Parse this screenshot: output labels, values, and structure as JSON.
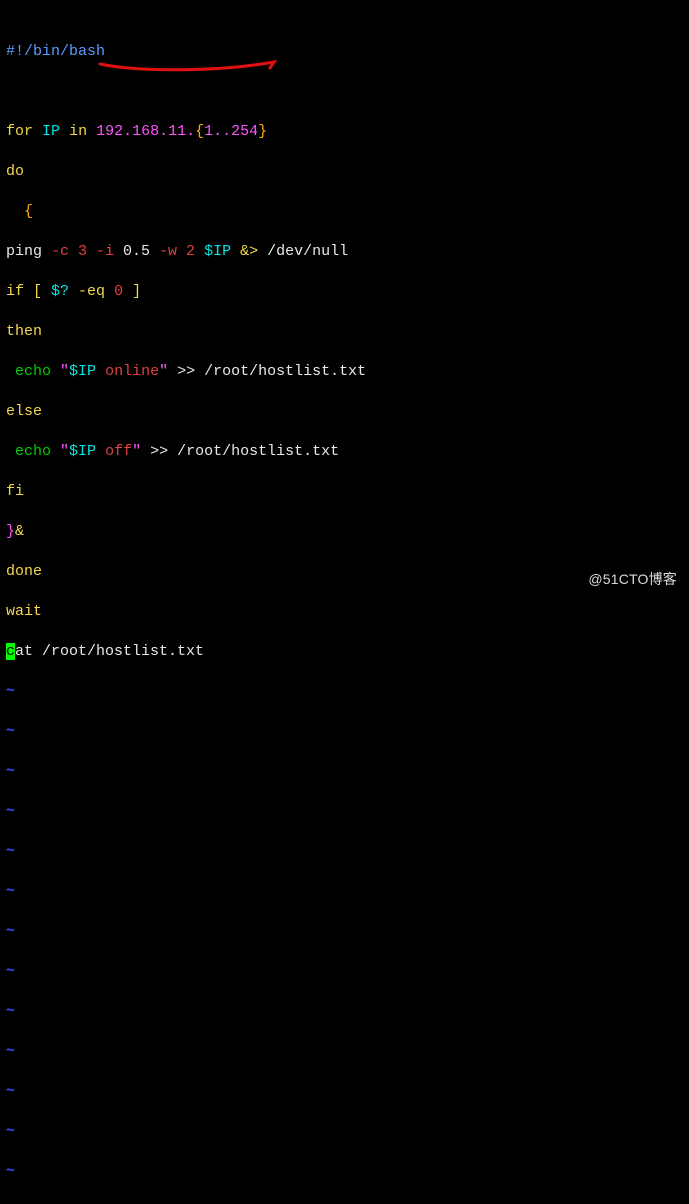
{
  "code": {
    "l1": {
      "shebang1": "#!",
      "shebang2": "/bin/bash"
    },
    "l3": {
      "for": "for",
      "var": "IP",
      "in": "in",
      "ipprefix": "192.168.11.",
      "lb": "{",
      "range": "1..254",
      "rb": "}"
    },
    "l4": {
      "do": "do"
    },
    "l5": {
      "indent": "  ",
      "brace": "{"
    },
    "l6": {
      "cmd": "ping",
      "flags": " -c 3 -i",
      "num": " 0.5",
      "flags2": " -w 2",
      "var": " $IP",
      "amp": " &>",
      "path": " /dev/null"
    },
    "l7": {
      "if": "if",
      "lb": " [ ",
      "var": "$?",
      "op": " -eq ",
      "zero": "0",
      "rb": " ]"
    },
    "l8": {
      "then": "then"
    },
    "l9": {
      "indent": " ",
      "echo": "echo",
      "q1": " \"",
      "var": "$IP",
      "txt": " online",
      "q2": "\"",
      "redir": " >> /root/hostlist.txt"
    },
    "l10": {
      "else": "else"
    },
    "l11": {
      "indent": " ",
      "echo": "echo",
      "q1": " \"",
      "var": "$IP",
      "txt": " off",
      "q2": "\"",
      "redir": " >> /root/hostlist.txt"
    },
    "l12": {
      "fi": "fi"
    },
    "l13": {
      "brace": "}",
      "amp": "&"
    },
    "l14": {
      "done": "done"
    },
    "l15": {
      "wait": "wait"
    },
    "l16": {
      "cur": "c",
      "rest": "at /root/hostlist.txt"
    },
    "tilde": "~"
  },
  "watermark": "@51CTO博客"
}
